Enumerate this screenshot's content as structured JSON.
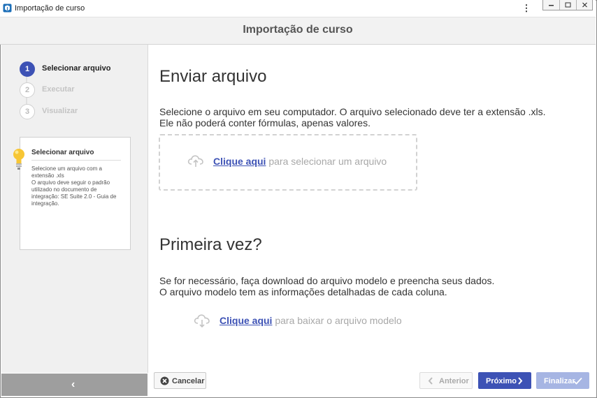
{
  "window": {
    "title": "Importação de curso"
  },
  "header": {
    "title": "Importação de curso"
  },
  "steps": [
    {
      "number": "1",
      "label": "Selecionar arquivo",
      "active": true
    },
    {
      "number": "2",
      "label": "Executar",
      "active": false
    },
    {
      "number": "3",
      "label": "Visualizar",
      "active": false
    }
  ],
  "tip": {
    "title": "Selecionar arquivo",
    "text": "Selecione um arquivo com a extensão .xls\nO arquivo deve seguir o padrão utilizado no documento de integração: SE Suite 2.0 - Guia de integração."
  },
  "upload": {
    "heading": "Enviar arquivo",
    "line1": "Selecione o arquivo em seu computador. O arquivo selecionado deve ter a extensão .xls.",
    "line2": "Ele não poderá conter fórmulas, apenas valores.",
    "link": "Clique aqui",
    "link_suffix": " para selecionar um arquivo"
  },
  "first_time": {
    "heading": "Primeira vez?",
    "line1": "Se for necessário, faça download do arquivo modelo e preencha seus dados.",
    "line2": "O arquivo modelo tem as informações detalhadas de cada coluna.",
    "link": "Clique aqui",
    "link_suffix": " para baixar o arquivo modelo"
  },
  "buttons": {
    "cancel": "Cancelar",
    "previous": "Anterior",
    "next": "Próximo",
    "finish": "Finalizar"
  },
  "colors": {
    "accent": "#3d52b5",
    "disabled_accent": "#a6b5e3",
    "sidebar_bg": "#f0f0f0"
  }
}
